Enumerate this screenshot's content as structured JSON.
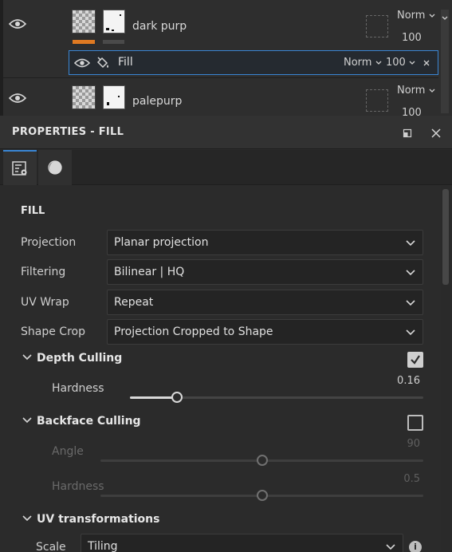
{
  "layers": [
    {
      "name": "dark purp",
      "blend_mode": "Norm",
      "opacity": "100"
    },
    {
      "name": "palepurp",
      "blend_mode": "Norm",
      "opacity": "100"
    }
  ],
  "fill_effect": {
    "name": "Fill",
    "blend_mode": "Norm",
    "opacity": "100"
  },
  "properties": {
    "title": "PROPERTIES - FILL",
    "section_title": "FILL",
    "projection": {
      "label": "Projection",
      "value": "Planar projection"
    },
    "filtering": {
      "label": "Filtering",
      "value": "Bilinear | HQ"
    },
    "uv_wrap": {
      "label": "UV Wrap",
      "value": "Repeat"
    },
    "shape_crop": {
      "label": "Shape Crop",
      "value": "Projection Cropped to Shape"
    },
    "depth_culling": {
      "label": "Depth Culling",
      "checked": true,
      "hardness": {
        "label": "Hardness",
        "value": "0.16",
        "fraction": 0.16
      }
    },
    "backface_culling": {
      "label": "Backface Culling",
      "checked": false,
      "angle": {
        "label": "Angle",
        "value": "90",
        "fraction": 0.5
      },
      "hardness": {
        "label": "Hardness",
        "value": "0.5",
        "fraction": 0.5
      }
    },
    "uv_transformations": {
      "label": "UV transformations",
      "scale": {
        "label": "Scale",
        "value": "Tiling"
      }
    }
  },
  "colors": {
    "accent": "#3a86d4",
    "orange_tag": "#e07a22"
  }
}
